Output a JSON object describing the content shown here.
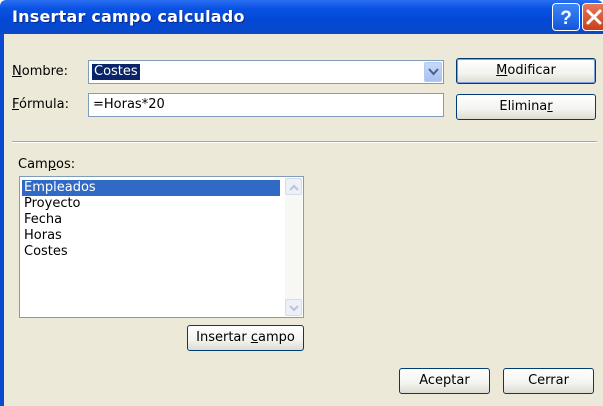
{
  "window": {
    "title": "Insertar campo calculado",
    "help_symbol": "?",
    "close_symbol": "✕"
  },
  "form": {
    "nombre_label_accel": "N",
    "nombre_label_rest": "ombre:",
    "nombre_value": "Costes",
    "formula_label_accel": "F",
    "formula_label_rest": "órmula:",
    "formula_value": "=Horas*20"
  },
  "buttons": {
    "modificar_accel": "M",
    "modificar_rest": "odificar",
    "eliminar_start": "Elimina",
    "eliminar_accel": "r",
    "insertar_start": "Insertar ",
    "insertar_accel": "c",
    "insertar_rest": "ampo",
    "aceptar": "Aceptar",
    "cerrar": "Cerrar"
  },
  "campos": {
    "label_start": "Cam",
    "label_accel": "p",
    "label_rest": "os:",
    "items": [
      "Empleados",
      "Proyecto",
      "Fecha",
      "Horas",
      "Costes"
    ],
    "selected_index": 0
  },
  "icons": {
    "dropdown": "chevron-down-icon",
    "scroll_up": "arrow-up-icon",
    "scroll_down": "arrow-down-icon",
    "help": "help-icon",
    "close": "close-icon"
  },
  "colors": {
    "titlebar": "#0a52e4",
    "selection": "#316ac5",
    "dialog_face": "#ece9d8"
  }
}
